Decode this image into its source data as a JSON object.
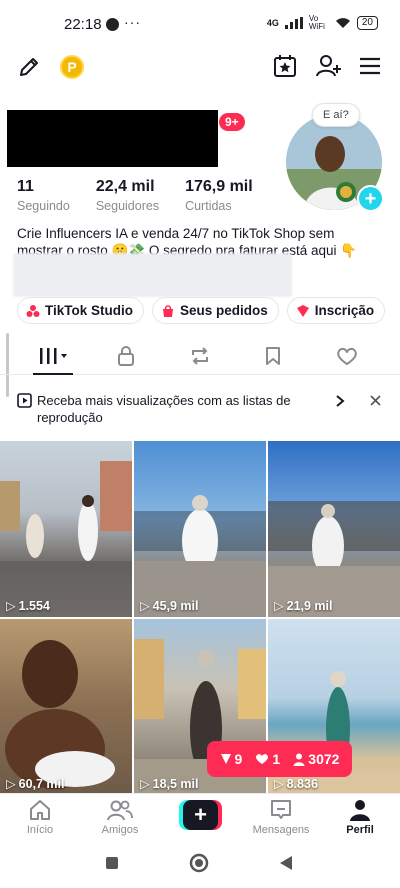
{
  "status_bar": {
    "time": "22:18",
    "more": "···",
    "network": "4G",
    "wifi_label": "Vo WiFi",
    "battery": "20"
  },
  "profile": {
    "notification_count": "9+",
    "avatar_bubble": "E aí?",
    "stats": [
      {
        "value": "11",
        "label": "Seguindo"
      },
      {
        "value": "22,4 mil",
        "label": "Seguidores"
      },
      {
        "value": "176,9 mil",
        "label": "Curtidas"
      }
    ],
    "bio_line1": "Crie Influencers IA e venda 24/7 no TikTok Shop sem",
    "bio_line2": "mostrar o rosto 🤫💸 O segredo pra faturar está aqui 👇"
  },
  "chips": [
    {
      "label": "TikTok Studio",
      "icon": "studio-icon"
    },
    {
      "label": "Seus pedidos",
      "icon": "orders-icon"
    },
    {
      "label": "Inscrição",
      "icon": "subscription-icon"
    }
  ],
  "banner": {
    "text": "Receba mais visualizações com as listas de reprodução"
  },
  "videos": [
    {
      "views": "1.554"
    },
    {
      "views": "45,9 mil"
    },
    {
      "views": "21,9 mil"
    },
    {
      "views": "60,7 mil"
    },
    {
      "views": "18,5 mil"
    },
    {
      "views": "8.836"
    }
  ],
  "live_stats": {
    "gifts": "9",
    "likes": "1",
    "viewers": "3072"
  },
  "nav": {
    "home": "Início",
    "friends": "Amigos",
    "create": "+",
    "inbox": "Mensagens",
    "profile": "Perfil"
  },
  "colors": {
    "accent": "#fe2c55",
    "cyan": "#25f4ee",
    "text": "#161823",
    "muted": "#8a8b91"
  }
}
